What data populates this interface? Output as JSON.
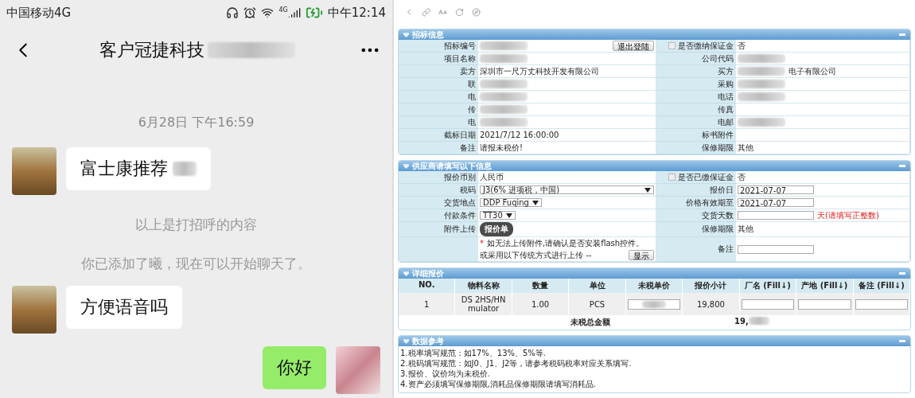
{
  "phone": {
    "status_bar": {
      "carrier": "中国移动4G",
      "network": "4G",
      "time": "中午12:14"
    },
    "header": {
      "title": "客户冠捷科技",
      "blurred": true
    },
    "messages": [
      {
        "kind": "timestamp",
        "text": "6月28日 下午16:59"
      },
      {
        "kind": "incoming",
        "text": "富士康推荐",
        "blurred": true
      },
      {
        "kind": "system",
        "text": "以上是打招呼的内容"
      },
      {
        "kind": "system",
        "text": "你已添加了曦，现在可以开始聊天了。"
      },
      {
        "kind": "incoming",
        "text": "方便语音吗"
      },
      {
        "kind": "outgoing",
        "text": "你好"
      },
      {
        "kind": "outgoing"
      }
    ]
  },
  "sections": [
    {
      "kind": "form",
      "title": "招标信息",
      "rows": [
        {
          "left": {
            "label": "招标编号",
            "fields": [
              {
                "kind": "blurred"
              },
              {
                "kind": "button",
                "text": "退出登陆"
              }
            ]
          },
          "right": {
            "label": "是否缴纳保证金",
            "checked": false,
            "fields": [
              {
                "kind": "text",
                "text": "否"
              }
            ]
          }
        },
        {
          "left": {
            "label": "项目名称",
            "fields": [
              {
                "kind": "blurred"
              }
            ]
          },
          "right": {
            "label": "公司代码",
            "fields": [
              {
                "kind": "blurred"
              }
            ]
          }
        },
        {
          "left": {
            "label": "卖方",
            "fields": [
              {
                "kind": "text",
                "text": "深圳市一尺万丈科技开发有限公司"
              }
            ]
          },
          "right": {
            "label": "买方",
            "fields": [
              {
                "kind": "blurred"
              },
              {
                "kind": "text",
                "text": "电子有限公司"
              }
            ]
          }
        },
        {
          "left": {
            "label": "联",
            "fields": [
              {
                "kind": "blurred"
              }
            ]
          },
          "right": {
            "label": "采购",
            "fields": [
              {
                "kind": "blurred"
              }
            ]
          }
        },
        {
          "left": {
            "label": "电",
            "fields": [
              {
                "kind": "blurred"
              }
            ]
          },
          "right": {
            "label": "电话",
            "fields": [
              {
                "kind": "blurred"
              }
            ]
          }
        },
        {
          "left": {
            "label": "传",
            "fields": [
              {
                "kind": "blurred"
              }
            ]
          },
          "right": {
            "label": "传真"
          }
        },
        {
          "left": {
            "label": "电",
            "fields": [
              {
                "kind": "blurred"
              }
            ]
          },
          "right": {
            "label": "电邮",
            "fields": [
              {
                "kind": "blurred"
              }
            ]
          }
        },
        {
          "left": {
            "label": "截标日期",
            "fields": [
              {
                "kind": "text",
                "text": "2021/7/12 16:00:00"
              }
            ]
          },
          "right": {
            "label": "标书附件"
          }
        },
        {
          "left": {
            "label": "备注",
            "fields": [
              {
                "kind": "text",
                "text": "请报未税价!"
              }
            ]
          },
          "right": {
            "label": "保修期限",
            "fields": [
              {
                "kind": "text",
                "text": "其他"
              }
            ]
          }
        }
      ]
    },
    {
      "kind": "form",
      "title": "供应商请填写以下信息",
      "rows": [
        {
          "left": {
            "label": "报价币别",
            "fields": [
              {
                "kind": "text",
                "text": "人民币"
              }
            ]
          },
          "right": {
            "label": "是否已缴保证金",
            "checked": false,
            "fields": [
              {
                "kind": "text",
                "text": "否"
              }
            ]
          }
        },
        {
          "left": {
            "label": "税码",
            "fields": [
              {
                "kind": "select",
                "text": "J3(6% 进项税，中国)",
                "wide": true
              }
            ]
          },
          "right": {
            "label": "报价日",
            "fields": [
              {
                "kind": "input",
                "value": "2021-07-07"
              }
            ]
          }
        },
        {
          "left": {
            "label": "交货地点",
            "fields": [
              {
                "kind": "select",
                "text": "DDP Fuqing",
                "wide": false
              }
            ]
          },
          "right": {
            "label": "价格有效期至",
            "fields": [
              {
                "kind": "input",
                "value": "2021-07-07"
              }
            ]
          }
        },
        {
          "left": {
            "label": "付款条件",
            "fields": [
              {
                "kind": "select",
                "text": "TT30",
                "wide": false
              }
            ]
          },
          "right": {
            "label": "交货天数",
            "fields": [
              {
                "kind": "input"
              },
              {
                "kind": "warning",
                "text": "天(请填写正整数)"
              }
            ]
          }
        },
        {
          "left": {
            "label": "附件上传",
            "fields": [
              {
                "kind": "upload",
                "text": "报价单"
              }
            ]
          },
          "right": {
            "label": "保修期限",
            "fields": [
              {
                "kind": "text",
                "text": "其他"
              }
            ]
          }
        },
        {
          "left": {
            "lines": [
              [
                {
                  "kind": "asterisk",
                  "text": "*"
                },
                {
                  "kind": "text",
                  "text": "如无法上传附件,请确认是否安装flash控件。"
                }
              ],
              [
                {
                  "kind": "text",
                  "text": "或采用以下传统方式进行上传 --"
                },
                {
                  "kind": "button",
                  "text": "显示"
                }
              ]
            ]
          },
          "right": {
            "label": "备注",
            "fields": [
              {
                "kind": "input"
              }
            ]
          }
        }
      ]
    },
    {
      "kind": "table",
      "title": "详细报价",
      "columns": [
        "NO.",
        "物料名称",
        "数量",
        "单位",
        "未税单价",
        "报价小计",
        "厂名 (Fill↓)",
        "产地 (Fill↓)",
        "备注 (Fill↓)"
      ],
      "rows": [
        {
          "cells": [
            {
              "kind": "text",
              "text": "1"
            },
            {
              "kind": "text",
              "text": "DS 2HS/HN mulator"
            },
            {
              "kind": "text",
              "text": "1.00"
            },
            {
              "kind": "text",
              "text": "PCS"
            },
            {
              "kind": "input",
              "blurred": true
            },
            {
              "kind": "text",
              "text": "19,800"
            },
            {
              "kind": "input"
            },
            {
              "kind": "input"
            },
            {
              "kind": "input"
            }
          ]
        }
      ],
      "total": {
        "label": "未税总金额",
        "value": "19,"
      }
    },
    {
      "kind": "notes",
      "title": "数据参考",
      "lines": [
        "1.税率填写规范：如17%、13%、5%等.",
        "2.税码填写规范：如J0、J1、J2等，请参考税码税率对应关系填写.",
        "3.报价、议价均为未税价.",
        "4.资产必须填写保修期限,消耗品保修期限请填写消耗品."
      ]
    }
  ]
}
